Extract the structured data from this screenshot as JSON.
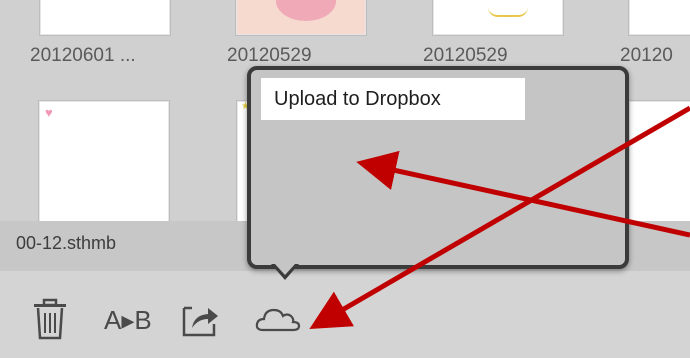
{
  "thumbnails": {
    "row1_labels": [
      "20120601 ...",
      "20120529",
      "20120529",
      "20120"
    ]
  },
  "selected_file": {
    "name": "00-12.sthmb"
  },
  "popup": {
    "title": "Upload to Dropbox"
  },
  "toolbar": {
    "delete_icon": "trash-icon",
    "rename_label": "A▸B",
    "share_icon": "share-icon",
    "upload_icon": "cloud-icon"
  },
  "colors": {
    "annotation_arrow": "#c00000",
    "popup_border": "#3b3b3b",
    "popup_fill": "#c5c5c5"
  }
}
